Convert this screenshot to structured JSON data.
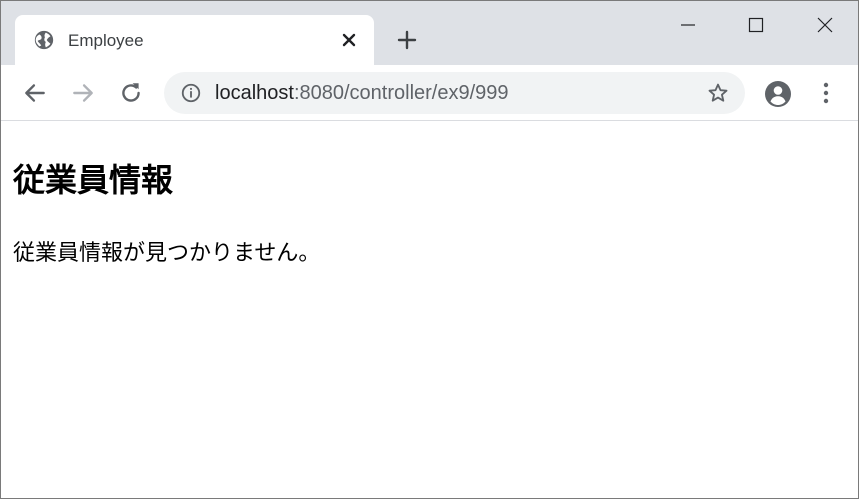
{
  "browser": {
    "tab": {
      "title": "Employee"
    },
    "address": {
      "host": "localhost",
      "rest": ":8080/controller/ex9/999"
    }
  },
  "page": {
    "heading": "従業員情報",
    "message": "従業員情報が見つかりません。"
  },
  "colors": {
    "titlebar": "#dee1e6",
    "omnibox": "#f1f3f4",
    "icon": "#5f6368",
    "icon_disabled": "#b0b3b8"
  }
}
